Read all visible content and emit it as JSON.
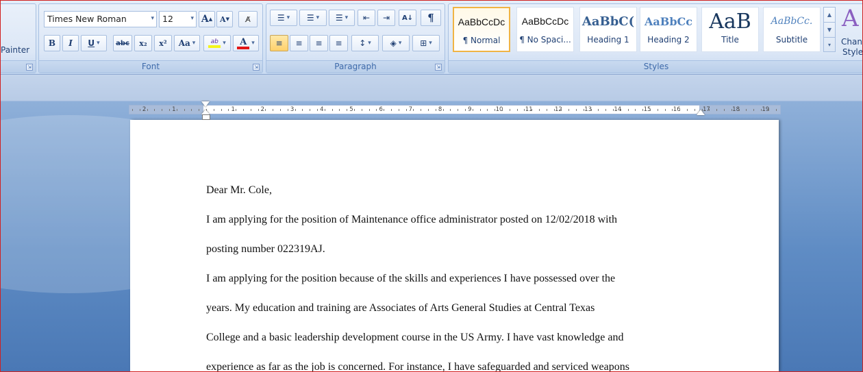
{
  "clipboard": {
    "painter_label": "Painter",
    "launcher": "⇲"
  },
  "font": {
    "name": "Times New Roman",
    "size": "12",
    "grow_label": "A",
    "shrink_label": "A",
    "clear_label": "A̸",
    "bold": "B",
    "italic": "I",
    "underline": "U",
    "strike": "abc",
    "subscript": "x₂",
    "superscript": "x²",
    "case": "Aa",
    "highlight": "ab",
    "font_color": "A",
    "highlight_color": "#f5f51a",
    "font_color_value": "#e21616",
    "group_label": "Font",
    "launcher": "⇲"
  },
  "paragraph": {
    "bullets": "☰",
    "numbering": "☰",
    "multilevel": "☰",
    "decrease_indent": "⇤",
    "increase_indent": "⇥",
    "sort": "A↓",
    "show_marks": "¶",
    "align_left": "≡",
    "align_center": "≡",
    "align_right": "≡",
    "justify": "≡",
    "line_spacing": "↕",
    "shading": "◈",
    "borders": "⊞",
    "group_label": "Paragraph",
    "launcher": "⇲"
  },
  "styles": {
    "group_label": "Styles",
    "items": [
      {
        "preview": "AaBbCcDc",
        "name": "¶ Normal",
        "selected": true
      },
      {
        "preview": "AaBbCcDc",
        "name": "¶ No Spaci...",
        "selected": false
      },
      {
        "preview": "AaBbC(",
        "name": "Heading 1",
        "selected": false
      },
      {
        "preview": "AaBbCc",
        "name": "Heading 2",
        "selected": false
      },
      {
        "preview": "AaB",
        "name": "Title",
        "selected": false
      },
      {
        "preview": "AaBbCc.",
        "name": "Subtitle",
        "selected": false
      }
    ],
    "change_styles_label_1": "Chan",
    "change_styles_label_2": "Style"
  },
  "ruler": {
    "left_numbers": [
      "2",
      "1"
    ],
    "right_numbers": [
      "1",
      "2",
      "3",
      "4",
      "5",
      "6",
      "7",
      "8",
      "9",
      "10",
      "11",
      "12",
      "13",
      "14",
      "15",
      "16",
      "17",
      "18",
      "19"
    ]
  },
  "document": {
    "paragraphs": [
      "Dear Mr. Cole,",
      "I am applying for the position of Maintenance office administrator posted on 12/02/2018 with",
      "posting number 022319AJ.",
      "I am applying for the position because of the skills and experiences I have possessed over the",
      "years. My education and training are Associates of Arts General Studies at Central Texas",
      "College and a basic leadership development course in the US Army. I have vast knowledge and",
      "experience as far as the job is concerned. For instance, I have safeguarded and serviced weapons"
    ]
  }
}
